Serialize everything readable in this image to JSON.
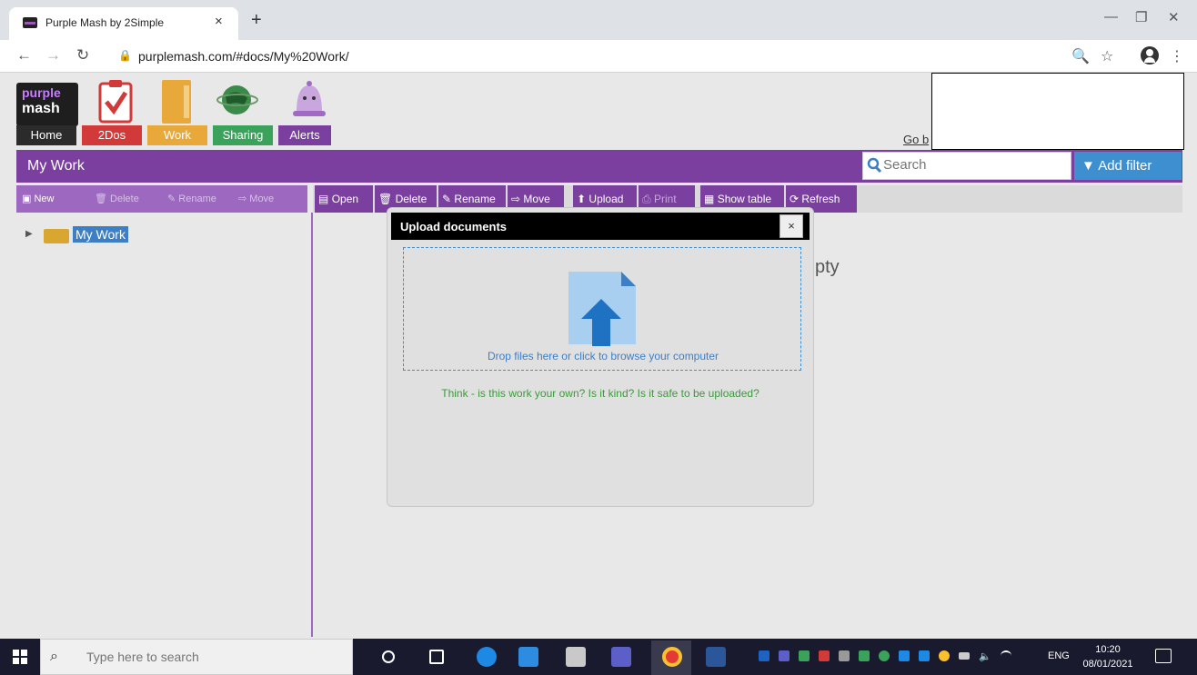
{
  "browser": {
    "tab_title": "Purple Mash by 2Simple",
    "tab_close": "×",
    "new_tab": "+",
    "url": "purplemash.com/#docs/My%20Work/",
    "minimize": "—",
    "restore": "❐",
    "close": "✕"
  },
  "logo": {
    "line1": "purple",
    "line2": "mash"
  },
  "nav": {
    "items": [
      {
        "label": "Home",
        "color": "#2b2b2b"
      },
      {
        "label": "2Dos",
        "color": "#d23a3a"
      },
      {
        "label": "Work",
        "color": "#e8a83a"
      },
      {
        "label": "Sharing",
        "color": "#3aa25a"
      },
      {
        "label": "Alerts",
        "color": "#7b3fa0"
      }
    ],
    "go_back": "Go b"
  },
  "page": {
    "title": "My Work",
    "search_placeholder": "Search",
    "add_filter": "Add filter"
  },
  "left_toolbar": {
    "new": "New",
    "delete": "Delete",
    "rename": "Rename",
    "move": "Move"
  },
  "right_toolbar": {
    "open": "Open",
    "delete": "Delete",
    "rename": "Rename",
    "move": "Move",
    "upload": "Upload",
    "print": "Print",
    "show_table": "Show table",
    "refresh": "Refresh"
  },
  "tree": {
    "root_label": "My Work"
  },
  "content": {
    "empty_fragment": "pty"
  },
  "modal": {
    "title": "Upload documents",
    "close": "×",
    "drop_text": "Drop files here or click to browse your computer",
    "warning": "Think - is this work your own? Is it kind? Is it safe to be uploaded?"
  },
  "taskbar": {
    "search_placeholder": "Type here to search",
    "lang": "ENG",
    "time": "10:20",
    "date": "08/01/2021"
  },
  "colors": {
    "purple": "#7b3fa0",
    "filter_blue": "#3d8fd0",
    "think_green": "#3b9a3b"
  }
}
